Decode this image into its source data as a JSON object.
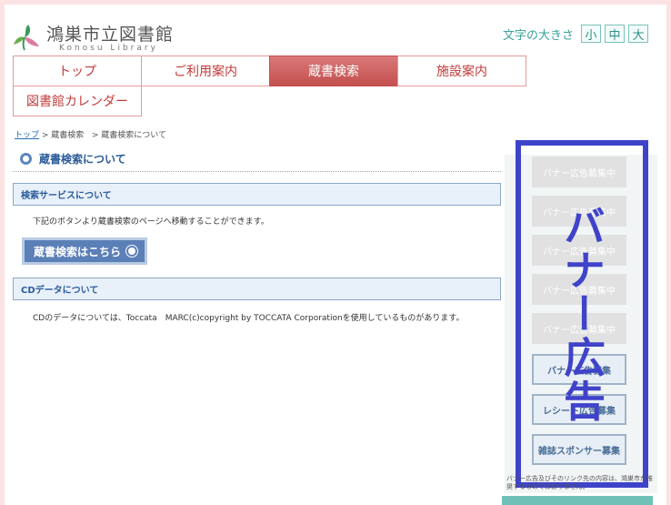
{
  "header": {
    "title": "鴻巣市立図書館",
    "subtitle": "Konosu Library",
    "fontsize_label": "文字の大きさ",
    "fontsize_options": [
      "小",
      "中",
      "大"
    ]
  },
  "nav": {
    "tabs": [
      "トップ",
      "ご利用案内",
      "蔵書検索",
      "施設案内"
    ],
    "calendar": "図書館カレンダー"
  },
  "breadcrumb": {
    "home": "トップ",
    "level1": "> 蔵書検索",
    "level2": "> 蔵書検索について"
  },
  "main": {
    "title": "蔵書検索について",
    "section1": {
      "heading": "検索サービスについて",
      "text": "下記のボタンより蔵書検索のページへ移動することができます。",
      "button": "蔵書検索はこちら"
    },
    "section2": {
      "heading": "CDデータについて",
      "text": "CDのデータについては、Toccata　MARC(c)copyright by TOCCATA Corporationを使用しているものがあります。"
    }
  },
  "sidebar": {
    "banners": [
      "バナー広告募集中",
      "バナー広告募集中",
      "バナー広告募集中",
      "バナー広告募集中",
      "バナー広告募集中"
    ],
    "outlined": [
      "バナー広告募集",
      "レシート広告募集",
      "雑誌スポンサー募集"
    ],
    "overlay": "バナー広告",
    "note": "バナー広告及びそのリンク先の内容は、鴻巣市が推奨するものではありません。"
  },
  "colors": {
    "accent_red": "#c44f4f",
    "accent_blue": "#3f43c9",
    "teal": "#3aa39a"
  }
}
